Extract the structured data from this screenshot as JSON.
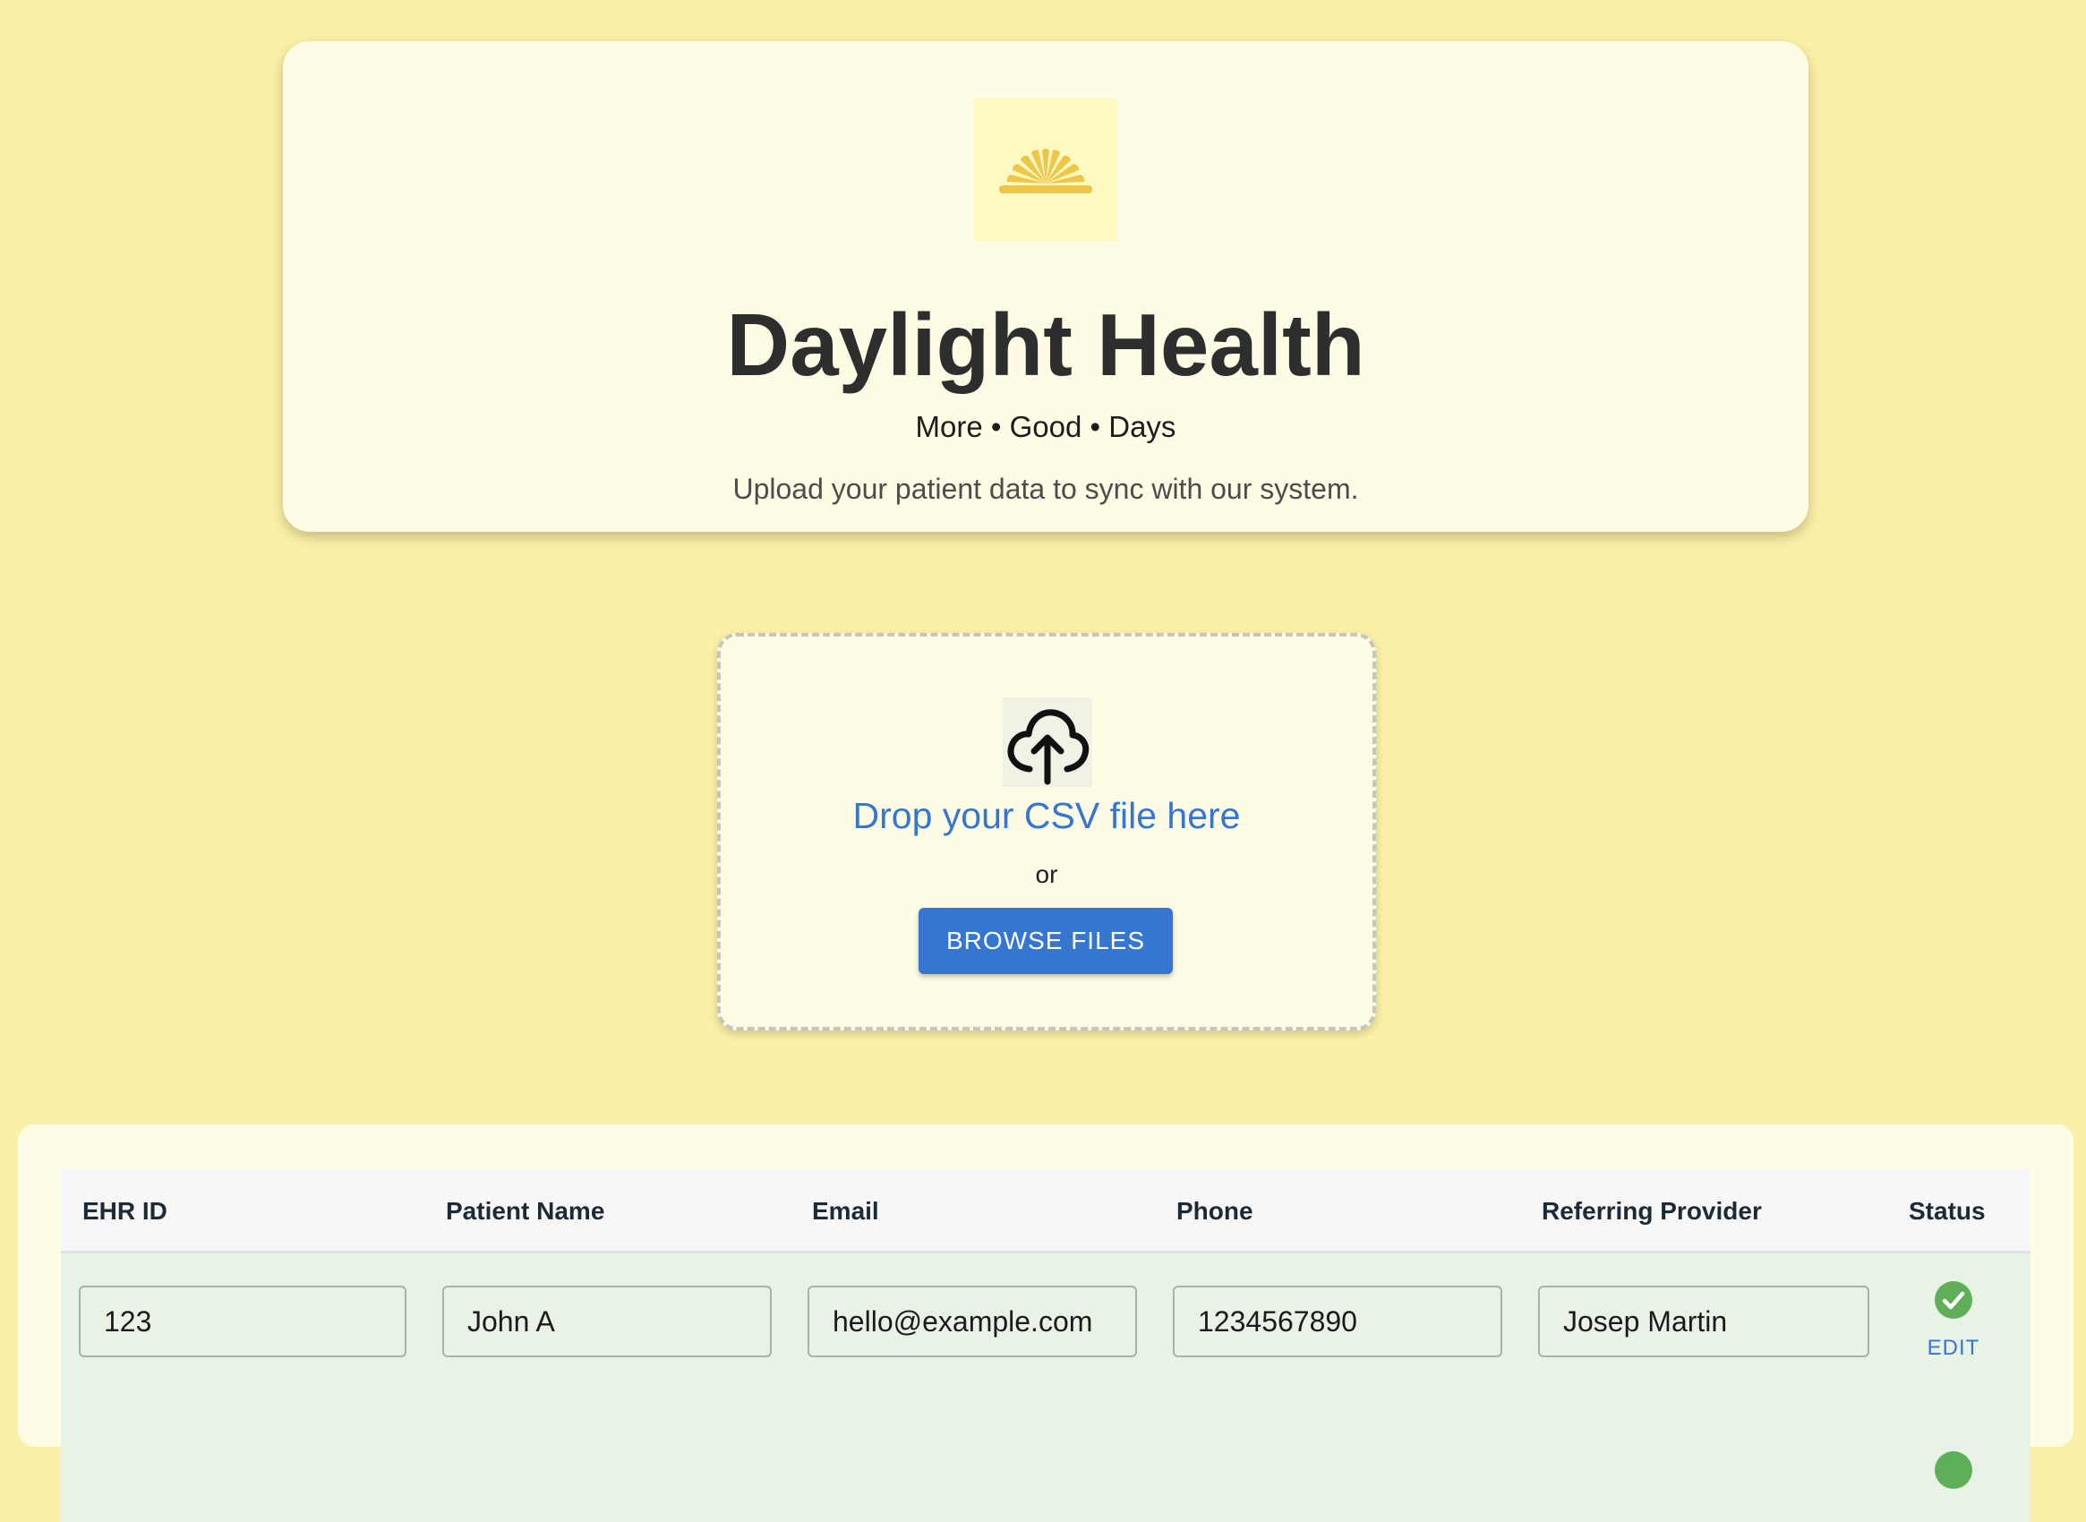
{
  "brand": {
    "logo_icon": "sunrise-icon",
    "title": "Daylight Health",
    "tagline": "More • Good • Days",
    "description": "Upload your patient data to sync with our system."
  },
  "dropzone": {
    "icon": "cloud-upload-icon",
    "drop_text": "Drop your CSV file here",
    "or_text": "or",
    "browse_label": "BROWSE FILES"
  },
  "table": {
    "headers": [
      "EHR ID",
      "Patient Name",
      "Email",
      "Phone",
      "Referring Provider",
      "Status"
    ],
    "rows": [
      {
        "ehr_id": "123",
        "patient_name": "John A",
        "email": "hello@example.com",
        "phone": "1234567890",
        "referring_provider": "Josep Martin",
        "status_icon": "check-circle-icon",
        "action_label": "EDIT"
      }
    ]
  },
  "colors": {
    "page_background": "#fbf0a8",
    "card_background": "#fefce4",
    "accent_blue": "#3576d0",
    "logo_gold": "#f0c64a",
    "success_green": "#5fae5a",
    "row_background": "#e8f3e6"
  }
}
